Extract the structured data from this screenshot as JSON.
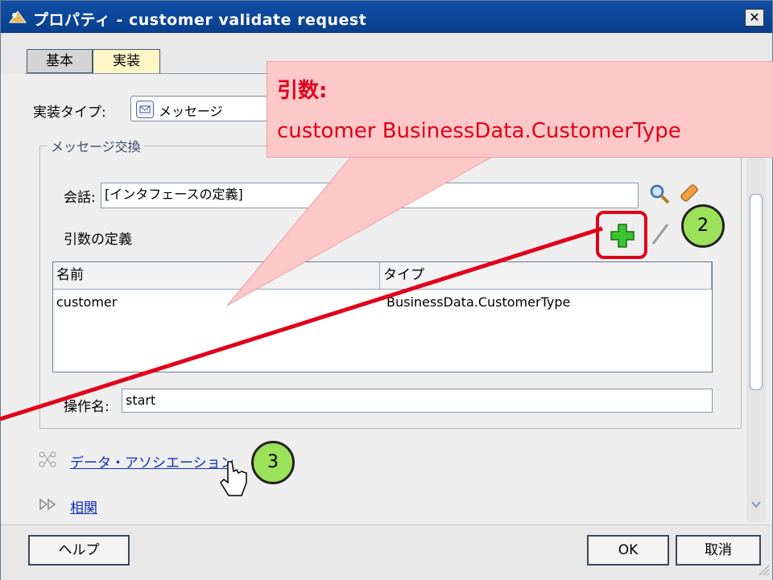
{
  "window": {
    "title": "プロパティ - customer validate request",
    "close_label": "✕"
  },
  "tabs": [
    {
      "label": "基本"
    },
    {
      "label": "実装"
    }
  ],
  "impl_type": {
    "label": "実装タイプ:",
    "value": "メッセージ"
  },
  "message_exchange": {
    "group_title": "メッセージ交換",
    "conversation_label": "会話:",
    "conversation_value": "[インタフェースの定義]",
    "arguments_label": "引数の定義",
    "table": {
      "columns": [
        "名前",
        "タイプ"
      ],
      "rows": [
        [
          "customer",
          "BusinessData.CustomerType"
        ]
      ]
    },
    "operation_label": "操作名:",
    "operation_value": "start"
  },
  "links": {
    "data_association": "データ・アソシエーション",
    "correlation": "相関"
  },
  "footer": {
    "help": "ヘルプ",
    "ok": "OK",
    "cancel": "取消"
  },
  "annotations": {
    "callout_title": "引数:",
    "callout_text": "customer    BusinessData.CustomerType",
    "step2": "2",
    "step3": "3"
  },
  "colors": {
    "titlebar": "#0f4fa6",
    "annotation_red": "#e0001a",
    "callout_fill": "#ffc8c8",
    "step_circle": "#9be15a"
  }
}
